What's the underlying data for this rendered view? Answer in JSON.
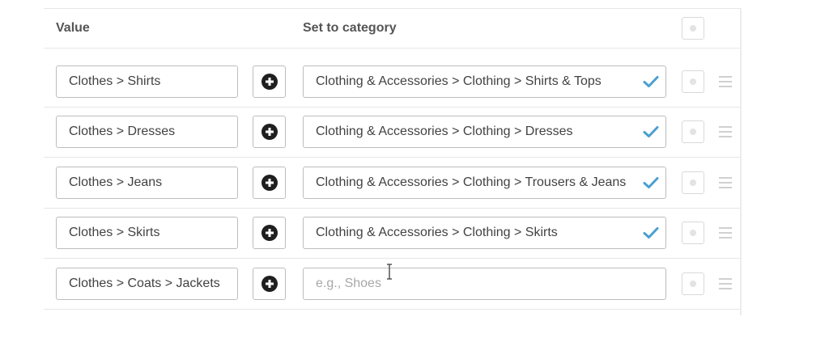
{
  "header": {
    "value_label": "Value",
    "category_label": "Set to category"
  },
  "rows": [
    {
      "value": "Clothes > Shirts",
      "category": "Clothing & Accessories > Clothing > Shirts & Tops",
      "confirmed": true
    },
    {
      "value": "Clothes > Dresses",
      "category": "Clothing & Accessories > Clothing > Dresses",
      "confirmed": true
    },
    {
      "value": "Clothes > Jeans",
      "category": "Clothing & Accessories > Clothing > Trousers & Jeans",
      "confirmed": true
    },
    {
      "value": "Clothes > Skirts",
      "category": "Clothing & Accessories > Clothing > Skirts",
      "confirmed": true
    },
    {
      "value": "Clothes > Coats > Jackets",
      "category": "",
      "category_placeholder": "e.g., Shoes",
      "confirmed": false
    }
  ],
  "icons": {
    "add": "plus-circle-icon",
    "confirm": "checkmark-icon",
    "drag": "drag-handle-icon",
    "cursor": "text-cursor-icon"
  },
  "colors": {
    "checkmark": "#4a9fd1",
    "border": "#bdbdbd",
    "text": "#424242",
    "placeholder": "#a8a8a8"
  }
}
